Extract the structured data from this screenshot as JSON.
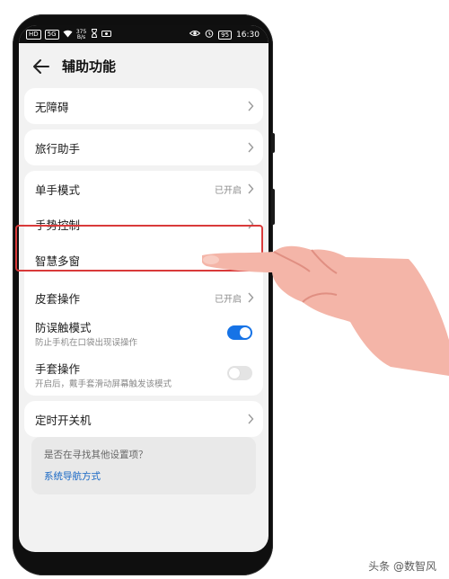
{
  "status_bar": {
    "left_chips": [
      "HD",
      "5G"
    ],
    "speed": "375 B/s",
    "battery": "95",
    "time": "16:30"
  },
  "header": {
    "title": "辅助功能"
  },
  "items": [
    {
      "label": "无障碍"
    },
    {
      "label": "旅行助手"
    },
    {
      "label": "单手模式",
      "status": "已开启"
    },
    {
      "label": "手势控制"
    },
    {
      "label": "智慧多窗"
    },
    {
      "label": "皮套操作",
      "status": "已开启"
    },
    {
      "label": "防误触模式",
      "sub": "防止手机在口袋出现误操作",
      "toggle": "on"
    },
    {
      "label": "手套操作",
      "sub": "开启后，戴手套滑动屏幕触发该模式",
      "toggle": "off"
    },
    {
      "label": "定时开关机"
    }
  ],
  "suggestion": {
    "question": "是否在寻找其他设置项？",
    "link": "系统导航方式"
  },
  "watermark": "头条 @数智风",
  "colors": {
    "accent_blue": "#1673e6",
    "highlight_red": "#d93a3a",
    "link_blue": "#1666c4"
  }
}
